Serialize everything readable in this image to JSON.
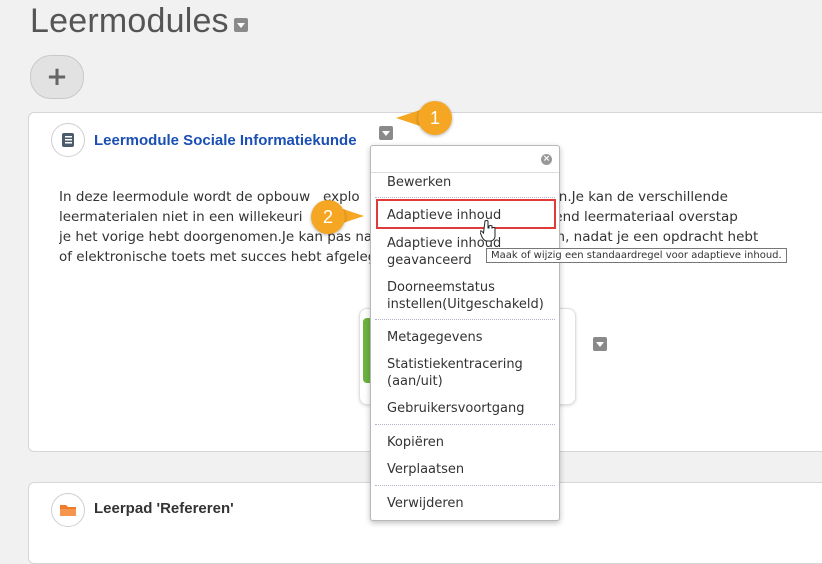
{
  "page": {
    "title": "Leermodules",
    "add_button": "+"
  },
  "module": {
    "title": "Leermodule Sociale Informatiekunde",
    "description_lines": [
      "In deze leermodule wordt de opbouw   explo                           tie besproken.Je kan de verschillende",
      "leermaterialen niet in een willekeuri                                     naar een volgend leermateriaal overstap",
      "je het vorige hebt doorgenomen.Je kan pas na                             erstappen, nadat je een opdracht hebt",
      "of elektronische toets met succes hebt afgelegd"
    ]
  },
  "context_menu": {
    "items": [
      "Bewerken",
      "Adaptieve inhoud",
      "Adaptieve inhoud",
      "geavanceerd",
      "Doorneemstatus",
      "instellen(Uitgeschakeld)",
      "Metagegevens",
      "Statistiekentracering",
      "(aan/uit)",
      "Gebruikersvoortgang",
      "Kopiëren",
      "Verplaatsen",
      "Verwijderen"
    ],
    "tooltip": "Maak of wijzig een standaardregel voor adaptieve inhoud."
  },
  "callouts": {
    "step1": "1",
    "step2": "2"
  },
  "learning_path": {
    "title": "Leerpad 'Refereren'"
  },
  "colors": {
    "link_blue": "#1a4fb4",
    "callout_orange": "#f5a623",
    "highlight_red": "#e03b3b"
  }
}
